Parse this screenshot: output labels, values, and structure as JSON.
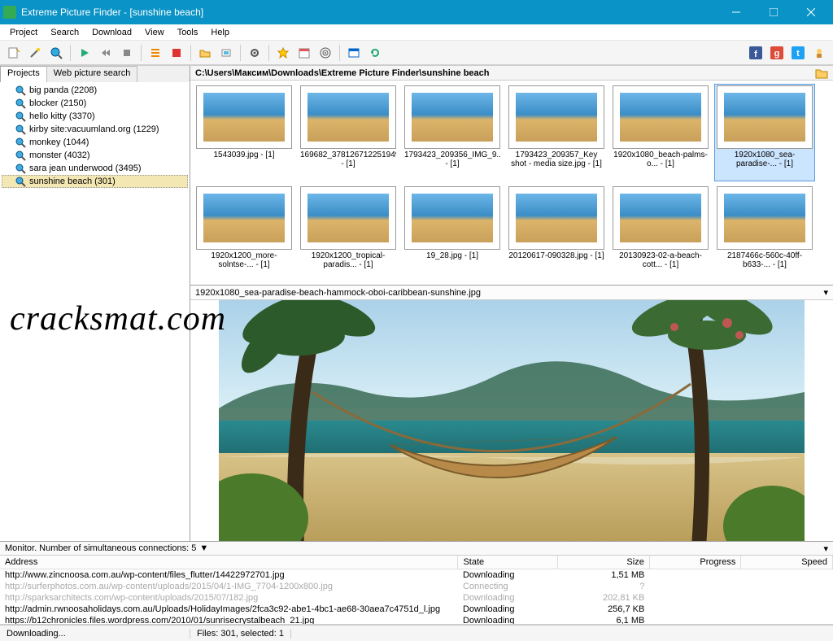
{
  "window": {
    "title": "Extreme Picture Finder - [sunshine beach]"
  },
  "menu": [
    "Project",
    "Search",
    "Download",
    "View",
    "Tools",
    "Help"
  ],
  "toolbar_icons": [
    "edit-icon",
    "magic-wand-icon",
    "search-web-icon",
    "sep",
    "play-icon",
    "rewind-icon",
    "stop-icon",
    "sep",
    "list-icon",
    "delete-icon",
    "sep",
    "folder-open-icon",
    "slideshow-icon",
    "sep",
    "gear-icon",
    "sep",
    "star-icon",
    "calendar-icon",
    "target-icon",
    "sep",
    "window-icon",
    "refresh-icon"
  ],
  "social_icons": [
    "facebook-icon",
    "google-icon",
    "twitter-icon",
    "vote-icon"
  ],
  "tabs": {
    "active": "Projects",
    "inactive": "Web picture search"
  },
  "projects": [
    {
      "label": "big panda (2208)"
    },
    {
      "label": "blocker (2150)"
    },
    {
      "label": "hello kitty (3370)"
    },
    {
      "label": "kirby site:vacuumland.org (1229)"
    },
    {
      "label": "monkey (1044)"
    },
    {
      "label": "monster (4032)"
    },
    {
      "label": "sara jean underwood (3495)"
    },
    {
      "label": "sunshine beach (301)",
      "selected": true
    }
  ],
  "path": "C:\\Users\\Максим\\Downloads\\Extreme Picture Finder\\sunshine beach",
  "thumbnails": [
    {
      "cap": "1543039.jpg - [1]"
    },
    {
      "cap": "169682_378126712251949... - [1]"
    },
    {
      "cap": "1793423_209356_IMG_9... - [1]"
    },
    {
      "cap": "1793423_209357_Key shot - media size.jpg - [1]"
    },
    {
      "cap": "1920x1080_beach-palms-o... - [1]"
    },
    {
      "cap": "1920x1080_sea-paradise-... - [1]",
      "selected": true
    },
    {
      "cap": "1920x1200_more-solntse-... - [1]"
    },
    {
      "cap": "1920x1200_tropical-paradis... - [1]"
    },
    {
      "cap": "19_28.jpg - [1]"
    },
    {
      "cap": "20120617-090328.jpg - [1]"
    },
    {
      "cap": "20130923-02-a-beach-cott... - [1]"
    },
    {
      "cap": "2187466c-560c-40ff-b633-... - [1]"
    }
  ],
  "preview_name": "1920x1080_sea-paradise-beach-hammock-oboi-caribbean-sunshine.jpg",
  "monitor": {
    "label": "Monitor. Number of simultaneous connections: 5",
    "dropdown_icon": "▼"
  },
  "dl_headers": [
    "Address",
    "State",
    "Size",
    "Progress",
    "Speed"
  ],
  "downloads": [
    {
      "addr": "http://www.zincnoosa.com.au/wp-content/files_flutter/14422972701.jpg",
      "state": "Downloading",
      "size": "1,51 MB",
      "dim": false
    },
    {
      "addr": "http://surferphotos.com.au/wp-content/uploads/2015/04/1-IMG_7704-1200x800.jpg",
      "state": "Connecting",
      "size": "?",
      "dim": true
    },
    {
      "addr": "http://sparksarchitects.com/wp-content/uploads/2015/07/182.jpg",
      "state": "Downloading",
      "size": "202,81 KB",
      "dim": true
    },
    {
      "addr": "http://admin.rwnoosaholidays.com.au/Uploads/HolidayImages/2fca3c92-abe1-4bc1-ae68-30aea7c4751d_l.jpg",
      "state": "Downloading",
      "size": "256,7 KB",
      "dim": false
    },
    {
      "addr": "https://b12chronicles.files.wordpress.com/2010/01/sunrisecrystalbeach_21.jpg",
      "state": "Downloading",
      "size": "6,1 MB",
      "dim": false
    }
  ],
  "status": {
    "left": "Downloading...",
    "mid": "Files: 301, selected: 1"
  },
  "watermark": "cracksmat.com"
}
